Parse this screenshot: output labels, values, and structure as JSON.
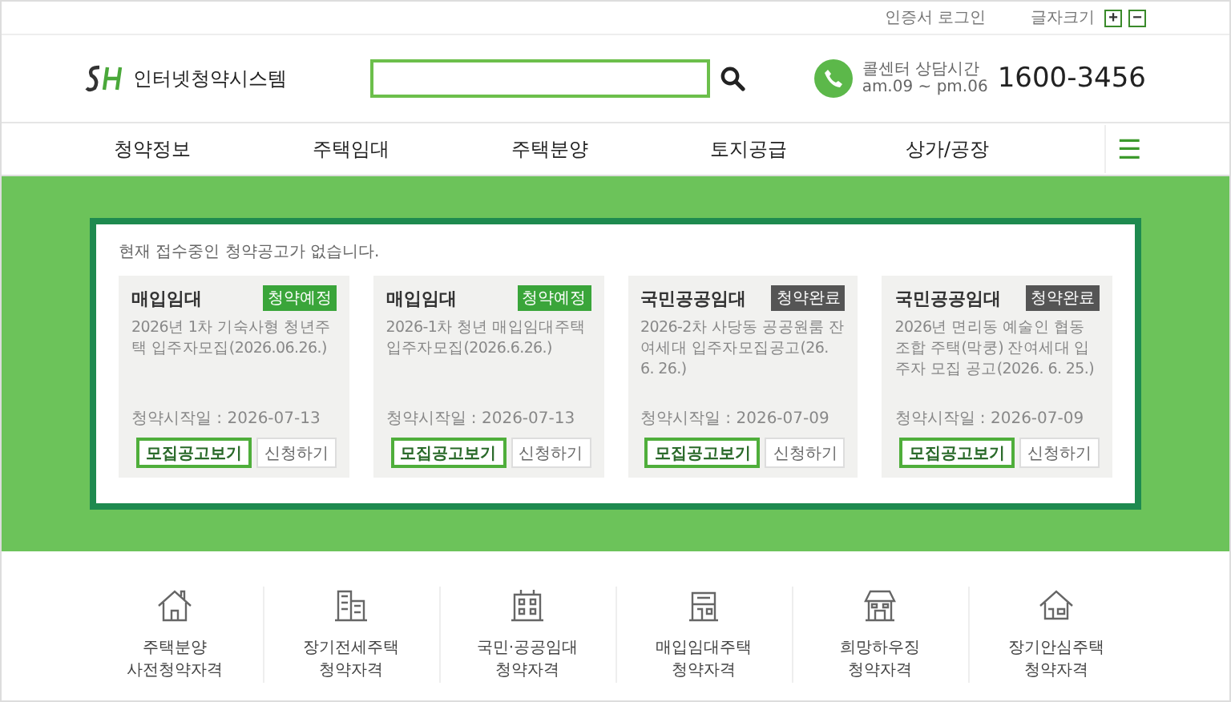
{
  "util_bar": {
    "login": "인증서 로그인",
    "font_size_label": "글자크기",
    "font_buttons": [
      "+",
      "−"
    ]
  },
  "header": {
    "logo_text": "인터넷청약시스템",
    "call_center": {
      "label": "콜센터 상담시간",
      "hours": "am.09 ~ pm.06",
      "phone": "1600-3456"
    }
  },
  "nav": {
    "items": [
      "청약정보",
      "주택임대",
      "주택분양",
      "토지공급",
      "상가/공장"
    ],
    "menu_icon": "☰"
  },
  "notice": {
    "message": "현재 접수중인 청약공고가 없습니다.",
    "cards": [
      {
        "category": "매입임대",
        "badge": {
          "text": "청약예정",
          "kind": "upcoming"
        },
        "title": "2026년 1차 기숙사형 청년주택 입주자모집(2026.06.26.)",
        "start_date": "청약시작일 : 2026-07-13",
        "buttons": [
          "모집공고보기",
          "신청하기"
        ]
      },
      {
        "category": "매입임대",
        "badge": {
          "text": "청약예정",
          "kind": "upcoming"
        },
        "title": "2026-1차 청년 매입임대주택 입주자모집(2026.6.26.)",
        "start_date": "청약시작일 : 2026-07-13",
        "buttons": [
          "모집공고보기",
          "신청하기"
        ]
      },
      {
        "category": "국민공공임대",
        "badge": {
          "text": "청약완료",
          "kind": "closed"
        },
        "title": "2026-2차 사당동 공공원룸 잔여세대 입주자모집공고(26. 6. 26.)",
        "start_date": "청약시작일 : 2026-07-09",
        "buttons": [
          "모집공고보기",
          "신청하기"
        ]
      },
      {
        "category": "국민공공임대",
        "badge": {
          "text": "청약완료",
          "kind": "closed"
        },
        "title": "2026년 면리동 예술인 협동조합 주택(막쿵) 잔여세대 입주자 모집 공고(2026. 6. 25.)",
        "start_date": "청약시작일 : 2026-07-09",
        "buttons": [
          "모집공고보기",
          "신청하기"
        ]
      }
    ]
  },
  "qualifications": [
    {
      "kind": "house",
      "lines": [
        "주택분양",
        "사전청약자격"
      ]
    },
    {
      "kind": "tower",
      "lines": [
        "장기전세주택",
        "청약자격"
      ]
    },
    {
      "kind": "apartment",
      "lines": [
        "국민·공공임대",
        "청약자격"
      ]
    },
    {
      "kind": "villa",
      "lines": [
        "매입임대주택",
        "청약자격"
      ]
    },
    {
      "kind": "townhouse",
      "lines": [
        "희망하우징",
        "청약자격"
      ]
    },
    {
      "kind": "cottage",
      "lines": [
        "장기안심주택",
        "청약자격"
      ]
    }
  ]
}
